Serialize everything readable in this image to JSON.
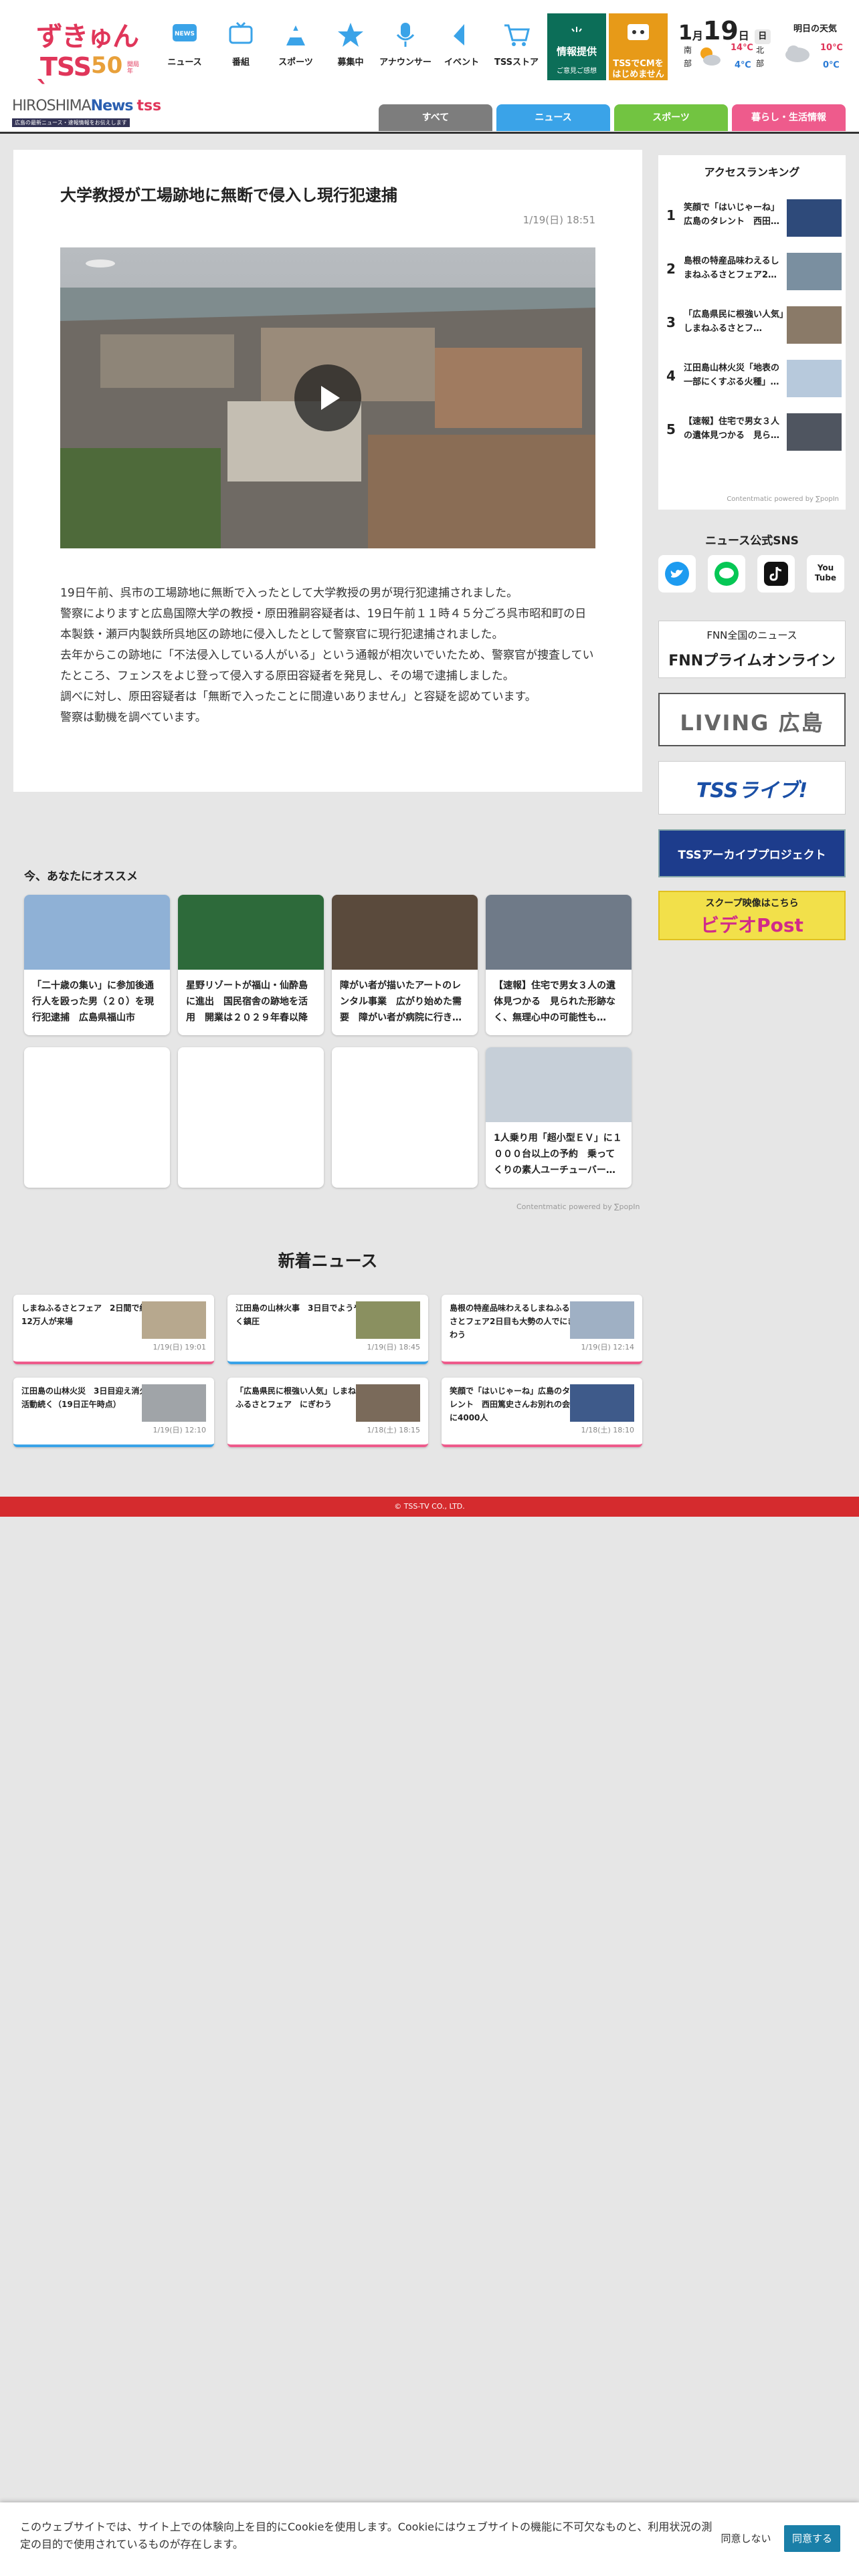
{
  "logo": {
    "zu": "ずきゅんˎ",
    "tss": "TSS",
    "fifty": "50",
    "anniversary": "開局年"
  },
  "nav": [
    {
      "label": "ニュース",
      "icon": "news-icon"
    },
    {
      "label": "番組",
      "icon": "tv-icon"
    },
    {
      "label": "スポーツ",
      "icon": "sports-icon"
    },
    {
      "label": "募集中",
      "icon": "star-icon"
    },
    {
      "label": "アナウンサー",
      "icon": "announcer-icon"
    },
    {
      "label": "イベント",
      "icon": "event-icon"
    },
    {
      "label": "TSSストア",
      "icon": "cart-icon"
    }
  ],
  "info_button": {
    "title": "情報提供",
    "sub": "ご意見ご感想"
  },
  "cm_button": {
    "title": "TSSでCMを\nはじめませんか？"
  },
  "date": {
    "month": "1",
    "day": "19",
    "dow": "日",
    "unit_month": "月",
    "unit_day": "日"
  },
  "weather": {
    "today_regions": [
      "南",
      "部",
      "北",
      "部"
    ],
    "south_hi": "14℃",
    "south_lo": "4℃",
    "tomorrow_label": "明日の天気",
    "tomorrow_hi": "10℃",
    "tomorrow_lo": "0℃",
    "hi_color": "#e0365a",
    "lo_color": "#2a7bd6"
  },
  "site": {
    "name_a": "HIROSHIMA",
    "name_b": "News",
    "brand": "tss",
    "sub": "広島の最新ニュース・速報情報をお伝えします"
  },
  "tabs": [
    {
      "label": "すべて",
      "color": "#7d7d7d"
    },
    {
      "label": "ニュース",
      "color": "#3aa3e8"
    },
    {
      "label": "スポーツ",
      "color": "#72c441"
    },
    {
      "label": "暮らし・生活情報",
      "color": "#ee5b8c"
    }
  ],
  "article": {
    "title": "大学教授が工場跡地に無断で侵入し現行犯逮捕",
    "timestamp": "1/19(日) 18:51",
    "paragraphs": [
      "19日午前、呉市の工場跡地に無断で入ったとして大学教授の男が現行犯逮捕されました。",
      "警察によりますと広島国際大学の教授・原田雅嗣容疑者は、19日午前１１時４５分ごろ呉市昭和町の日本製鉄・瀬戸内製鉄所呉地区の跡地に侵入したとして警察官に現行犯逮捕されました。",
      "去年からこの跡地に「不法侵入している人がいる」という通報が相次いでいたため、警察官が捜査していたところ、フェンスをよじ登って侵入する原田容疑者を発見し、その場で逮捕しました。",
      "調べに対し、原田容疑者は「無断で入ったことに間違いありません」と容疑を認めています。",
      "警察は動機を調べています。"
    ]
  },
  "ranking": {
    "title": "アクセスランキング",
    "items": [
      {
        "rank": "1",
        "text": "笑顔で「はいじゃーね」広島のタレント　西田…"
      },
      {
        "rank": "2",
        "text": "島根の特産品味わえるしまねふるさとフェア2…"
      },
      {
        "rank": "3",
        "text": "「広島県民に根強い人気」しまねふるさとフ…"
      },
      {
        "rank": "4",
        "text": "江田島山林火災「地表の一部にくすぶる火種」…"
      },
      {
        "rank": "5",
        "text": "【速報】住宅で男女３人の遺体見つかる　見ら…"
      }
    ],
    "powered": "Contentmatic powered by ∑popIn"
  },
  "sns": {
    "title": "ニュース公式SNS",
    "items": [
      "twitter-icon",
      "line-icon",
      "tiktok-icon",
      "youtube-icon"
    ],
    "youtube_label": "You\nTube"
  },
  "banners": {
    "fnn_small": "FNN全国のニュース",
    "fnn_big": "FNNプライムオンライン",
    "living": "LIVING 広島",
    "live": "TSSライブ!",
    "archive": "TSSアーカイブプロジェクト",
    "video_top": "スクープ映像はこちら",
    "video_main": "ビデオPost"
  },
  "recommend": {
    "title": "今、あなたにオススメ",
    "cards": [
      {
        "text": "「二十歳の集い」に参加後通行人を殴った男（２０）を現行犯逮捕　広島県福山市",
        "bg": "#8fb1d6"
      },
      {
        "text": "星野リゾートが福山・仙酔島に進出　国民宿舎の跡地を活用　開業は２０２９年春以降",
        "bg": "#2d6a3a"
      },
      {
        "text": "障がい者が描いたアートのレンタル事業　広がり始めた需要　障がい者が病院に行き…",
        "bg": "#5a4a3c"
      },
      {
        "text": "【速報】住宅で男女３人の遺体見つかる　見られた形跡なく、無理心中の可能性も…",
        "bg": "#6f7a88"
      },
      {
        "text": "",
        "bg": "#ffffff"
      },
      {
        "text": "",
        "bg": "#ffffff"
      },
      {
        "text": "",
        "bg": "#ffffff"
      },
      {
        "text": "1人乗り用「超小型ＥＶ」に１０００台以上の予約　乗ってくりの素人ユーチューバー…",
        "bg": "#c6cfd8"
      }
    ],
    "powered": "Contentmatic powered by ∑popIn"
  },
  "new_news": {
    "title": "新着ニュース",
    "items": [
      {
        "text": "しまねふるさとフェア　2日間で約12万人が来場",
        "date": "1/19(日) 19:01",
        "accent": "#ee5b8c"
      },
      {
        "text": "江田島の山林火事　3日目でようやく鎮圧",
        "date": "1/19(日) 18:45",
        "accent": "#3aa3e8"
      },
      {
        "text": "島根の特産品味わえるしまねふるさとフェア2日目も大勢の人でにぎわう",
        "date": "1/19(日) 12:14",
        "accent": "#ee5b8c"
      },
      {
        "text": "江田島の山林火災　3日目迎え消火活動続く（19日正午時点）",
        "date": "1/19(日) 12:10",
        "accent": "#3aa3e8"
      },
      {
        "text": "「広島県民に根強い人気」しまねふるさとフェア　にぎわう",
        "date": "1/18(土) 18:15",
        "accent": "#ee5b8c"
      },
      {
        "text": "笑顔で「はいじゃーね」広島のタレント　西田篤史さんお別れの会に4000人",
        "date": "1/18(土) 18:10",
        "accent": "#ee5b8c"
      }
    ]
  },
  "footer": {
    "copyright": "© TSS-TV CO., LTD."
  },
  "cookie": {
    "text": "このウェブサイトでは、サイト上での体験向上を目的にCookieを使用します。Cookieにはウェブサイトの機能に不可欠なものと、利用状況の測定の目的で使用されているものが存在します。",
    "decline": "同意しない",
    "accept": "同意する"
  }
}
